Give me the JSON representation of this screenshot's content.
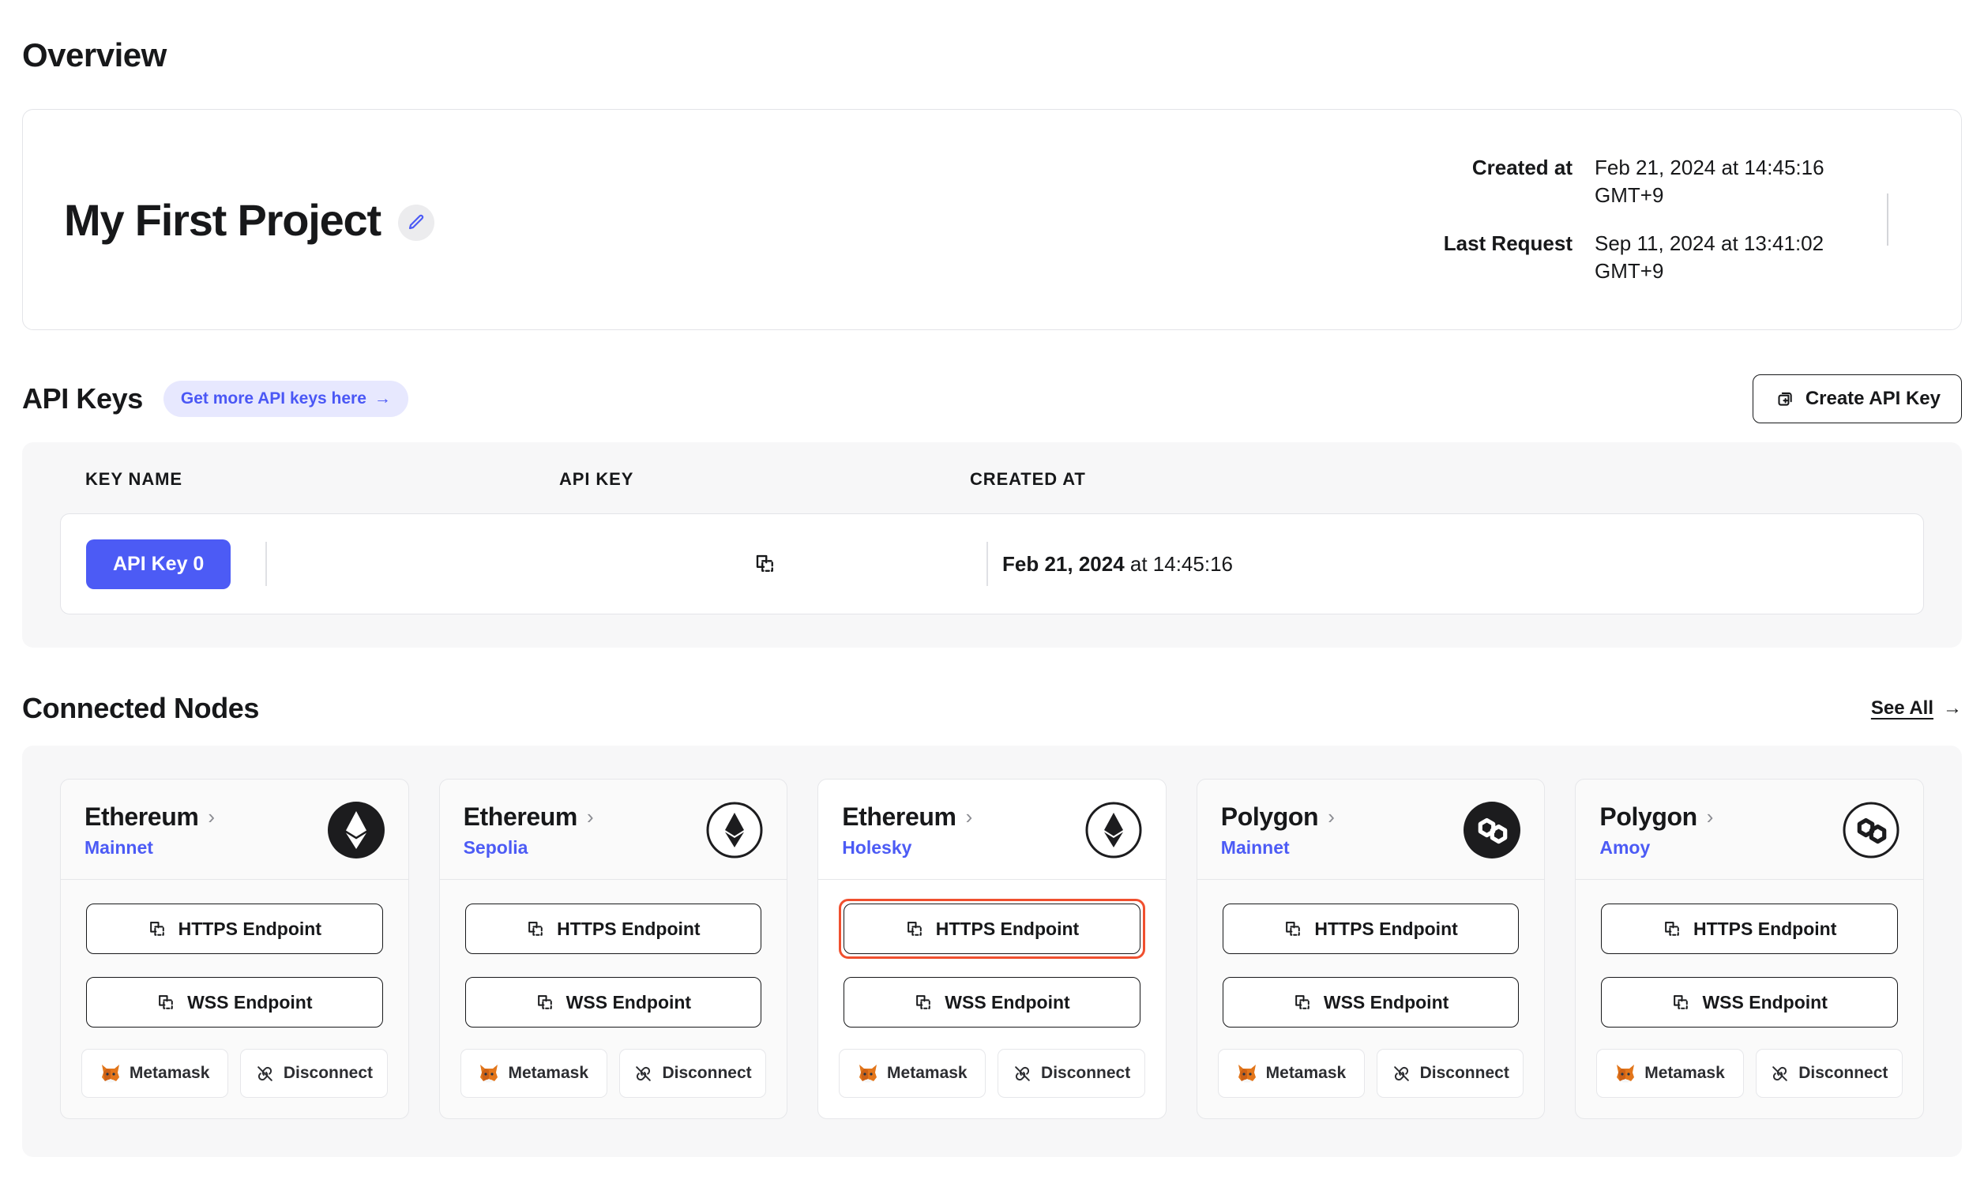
{
  "page": {
    "title": "Overview"
  },
  "project": {
    "name": "My First Project",
    "edit_icon": "pencil-icon",
    "meta": [
      {
        "label": "Created at",
        "value": "Feb 21, 2024 at 14:45:16 GMT+9"
      },
      {
        "label": "Last Request",
        "value": "Sep 11, 2024 at 13:41:02 GMT+9"
      }
    ]
  },
  "api_keys": {
    "title": "API Keys",
    "pill_label": "Get more API keys here",
    "pill_arrow": "→",
    "create_button": "Create API Key",
    "create_icon": "copy-plus-icon",
    "columns": [
      "KEY NAME",
      "API KEY",
      "CREATED AT"
    ],
    "rows": [
      {
        "key_name": "API Key 0",
        "api_key_icon": "copy-icon",
        "created_at_bold": "Feb 21, 2024",
        "created_at_rest": " at 14:45:16"
      }
    ]
  },
  "connected_nodes": {
    "title": "Connected Nodes",
    "see_all": "See All",
    "see_all_arrow": "→",
    "cards": [
      {
        "chain": "Ethereum",
        "network": "Mainnet",
        "logo": "ethereum-logo",
        "logo_style": "filled",
        "selected": false,
        "highlight_https": false,
        "https_label": "HTTPS Endpoint",
        "wss_label": "WSS Endpoint",
        "metamask_label": "Metamask",
        "disconnect_label": "Disconnect"
      },
      {
        "chain": "Ethereum",
        "network": "Sepolia",
        "logo": "ethereum-logo",
        "logo_style": "outline",
        "selected": false,
        "highlight_https": false,
        "https_label": "HTTPS Endpoint",
        "wss_label": "WSS Endpoint",
        "metamask_label": "Metamask",
        "disconnect_label": "Disconnect"
      },
      {
        "chain": "Ethereum",
        "network": "Holesky",
        "logo": "ethereum-logo",
        "logo_style": "outline",
        "selected": true,
        "highlight_https": true,
        "https_label": "HTTPS Endpoint",
        "wss_label": "WSS Endpoint",
        "metamask_label": "Metamask",
        "disconnect_label": "Disconnect"
      },
      {
        "chain": "Polygon",
        "network": "Mainnet",
        "logo": "polygon-logo",
        "logo_style": "filled",
        "selected": false,
        "highlight_https": false,
        "https_label": "HTTPS Endpoint",
        "wss_label": "WSS Endpoint",
        "metamask_label": "Metamask",
        "disconnect_label": "Disconnect"
      },
      {
        "chain": "Polygon",
        "network": "Amoy",
        "logo": "polygon-logo",
        "logo_style": "outline",
        "selected": false,
        "highlight_https": false,
        "https_label": "HTTPS Endpoint",
        "wss_label": "WSS Endpoint",
        "metamask_label": "Metamask",
        "disconnect_label": "Disconnect"
      }
    ]
  },
  "colors": {
    "accent_blue": "#4c5bf5",
    "pill_bg": "#e7e8fe",
    "panel_bg": "#f7f7f8",
    "highlight_red": "#f0502f",
    "text": "#17181a"
  }
}
